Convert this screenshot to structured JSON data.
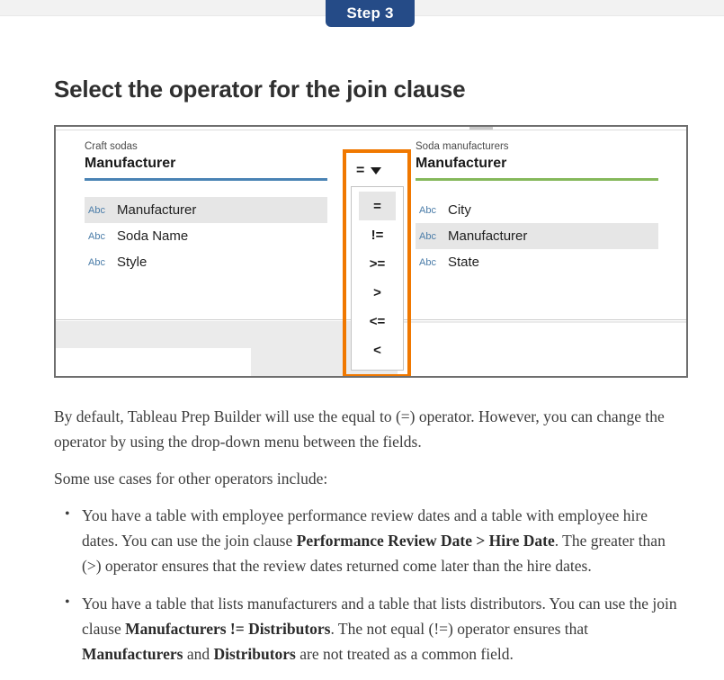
{
  "badge": {
    "label": "Step 3"
  },
  "heading": {
    "title": "Select the operator for the join clause"
  },
  "figure": {
    "left_panel": {
      "table_label": "Craft sodas",
      "field_title": "Manufacturer",
      "rule_color": "#4a83b4",
      "fields": [
        {
          "type_label": "Abc",
          "name": "Manufacturer",
          "selected": true
        },
        {
          "type_label": "Abc",
          "name": "Soda Name",
          "selected": false
        },
        {
          "type_label": "Abc",
          "name": "Style",
          "selected": false
        }
      ]
    },
    "right_panel": {
      "table_label": "Soda manufacturers",
      "field_title": "Manufacturer",
      "rule_color": "#85b85b",
      "fields": [
        {
          "type_label": "Abc",
          "name": "City",
          "selected": false
        },
        {
          "type_label": "Abc",
          "name": "Manufacturer",
          "selected": true
        },
        {
          "type_label": "Abc",
          "name": "State",
          "selected": false
        }
      ]
    },
    "operator": {
      "current": "=",
      "caret_icon": "chevron-down-icon",
      "options": [
        {
          "label": "=",
          "selected": true
        },
        {
          "label": "!=",
          "selected": false
        },
        {
          "label": ">=",
          "selected": false
        },
        {
          "label": ">",
          "selected": false
        },
        {
          "label": "<=",
          "selected": false
        },
        {
          "label": "<",
          "selected": false
        }
      ]
    },
    "callout_color": "#f07800"
  },
  "prose": {
    "paragraph_1_a": "By default, Tableau Prep Builder will use the equal to (=) operator. However, you can change the operator by using the drop-down menu between the fields.",
    "paragraph_2": "Some use cases for other operators include:",
    "bullets": [
      {
        "part_1": "You have a table with employee performance review dates and a table with employee hire dates. You can use the join clause ",
        "bold_1": "Performance Review Date > Hire Date",
        "part_2": ". The greater than (>) operator ensures that the review dates returned come later than the hire dates."
      },
      {
        "part_1": "You have a table that lists manufacturers and a table that lists distributors. You can use the join clause ",
        "bold_1": "Manufacturers != Distributors",
        "part_2": ". The not equal (!=) operator ensures that ",
        "bold_2": "Manufacturers",
        "part_3": " and ",
        "bold_3": "Distributors",
        "part_4": " are not treated as a common field."
      }
    ]
  }
}
